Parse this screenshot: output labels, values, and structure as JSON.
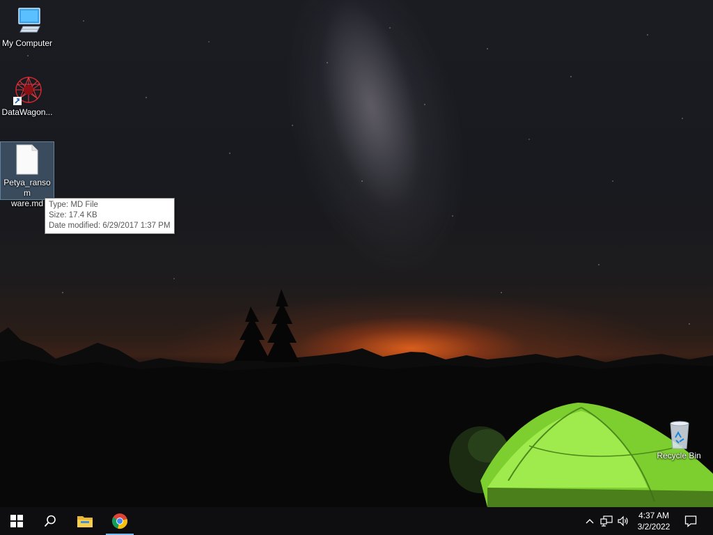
{
  "desktop": {
    "icons": [
      {
        "label": "My Computer",
        "icon": "computer-icon"
      },
      {
        "label": "DataWagon...",
        "icon": "datawagon-app-icon"
      },
      {
        "label": "Petya_ransomware.md",
        "label_line1": "Petya_ransom",
        "label_line2": "ware.md",
        "icon": "document-file-icon",
        "selected": true
      },
      {
        "label": "Recycle Bin",
        "icon": "recycle-bin-icon"
      }
    ]
  },
  "tooltip": {
    "type": "Type: MD File",
    "size": "Size: 17.4 KB",
    "modified": "Date modified: 6/29/2017 1:37 PM"
  },
  "taskbar": {
    "buttons": [
      {
        "name": "start",
        "icon": "windows-logo-icon"
      },
      {
        "name": "search",
        "icon": "search-icon"
      },
      {
        "name": "file-explorer",
        "icon": "folder-icon"
      },
      {
        "name": "chrome",
        "icon": "chrome-icon",
        "active": true
      }
    ],
    "tray": {
      "icons": [
        "chevron-up-icon",
        "network-icon",
        "volume-icon"
      ],
      "time": "4:37 AM",
      "date": "3/2/2022",
      "notification_icon": "action-center-icon"
    }
  },
  "colors": {
    "taskbar_bg": "#0e0e10",
    "active_indicator": "#76b9ed",
    "tent": "#8fe03a"
  }
}
